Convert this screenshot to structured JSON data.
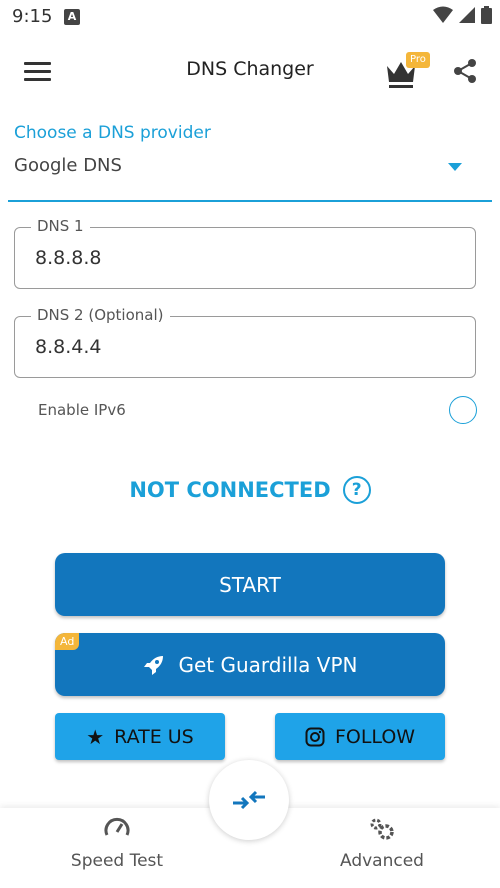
{
  "status_bar": {
    "time": "9:15",
    "notification_letter": "A"
  },
  "app_bar": {
    "title": "DNS Changer",
    "pro_badge": "Pro"
  },
  "provider": {
    "label": "Choose a DNS provider",
    "selected": "Google DNS"
  },
  "dns1": {
    "label": "DNS 1",
    "value": "8.8.8.8"
  },
  "dns2": {
    "label": "DNS 2 (Optional)",
    "value": "8.8.4.4"
  },
  "ipv6": {
    "label": "Enable IPv6",
    "enabled": false
  },
  "connection": {
    "status": "NOT CONNECTED",
    "help_glyph": "?"
  },
  "buttons": {
    "start": "START",
    "vpn": "Get Guardilla VPN",
    "ad_badge": "Ad",
    "rate": "RATE US",
    "follow": "FOLLOW"
  },
  "bottom_nav": {
    "left": "Speed Test",
    "right": "Advanced"
  },
  "colors": {
    "accent": "#1ba0d8",
    "primary_button": "#1276bd",
    "secondary_button": "#1fa3e8",
    "badge": "#f4b63a"
  }
}
